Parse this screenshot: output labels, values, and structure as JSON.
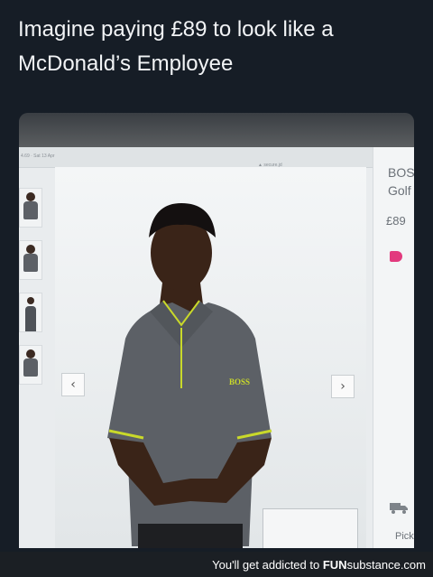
{
  "post": {
    "caption": "Imagine paying £89 to look like a McDonald’s Employee"
  },
  "product_page": {
    "breadcrumb": "4.69 · Sat 13 Apr",
    "header_mid": "▲ secure.jd",
    "brand_title": "BOS\nGolf",
    "price": "£89",
    "shirt_logo": "BOSS",
    "delivery_label": "Pick you",
    "prev_arrow": "‹",
    "next_arrow": "›"
  },
  "footer": {
    "tagline": "You'll get addicted to ",
    "brand_prefix": "FUN",
    "brand_suffix": "substance.com"
  },
  "colors": {
    "background": "#161d26",
    "shirt": "#5c6066",
    "shirt_trim": "#c9d92a",
    "tag": "#e23a7e"
  }
}
